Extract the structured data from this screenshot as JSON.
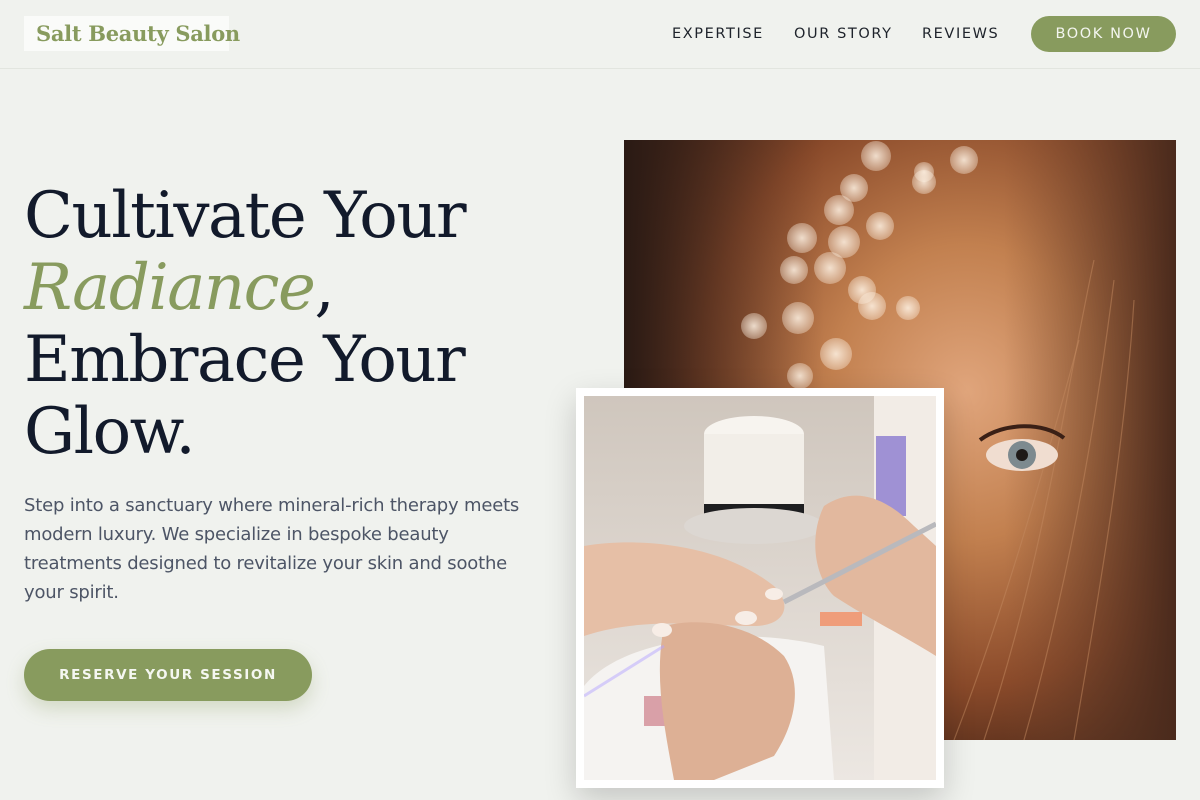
{
  "brand": {
    "name": "Salt Beauty Salon",
    "accent_color": "#889b5e",
    "text_color": "#121a2b"
  },
  "nav": {
    "links": [
      "EXPERTISE",
      "OUR STORY",
      "REVIEWS"
    ],
    "cta_label": "BOOK NOW"
  },
  "hero": {
    "title_line1": "Cultivate Your",
    "title_accent": "Radiance",
    "title_comma": ",",
    "title_line3": "Embrace Your",
    "title_line4": "Glow.",
    "description": "Step into a sanctuary where mineral-rich therapy meets modern luxury. We specialize in bespoke beauty treatments designed to revitalize your skin and soothe your spirit.",
    "cta_label": "RESERVE YOUR SESSION"
  },
  "images": {
    "main": "face-with-freckles-bokeh-photo",
    "inset": "manicure-treatment-photo"
  }
}
